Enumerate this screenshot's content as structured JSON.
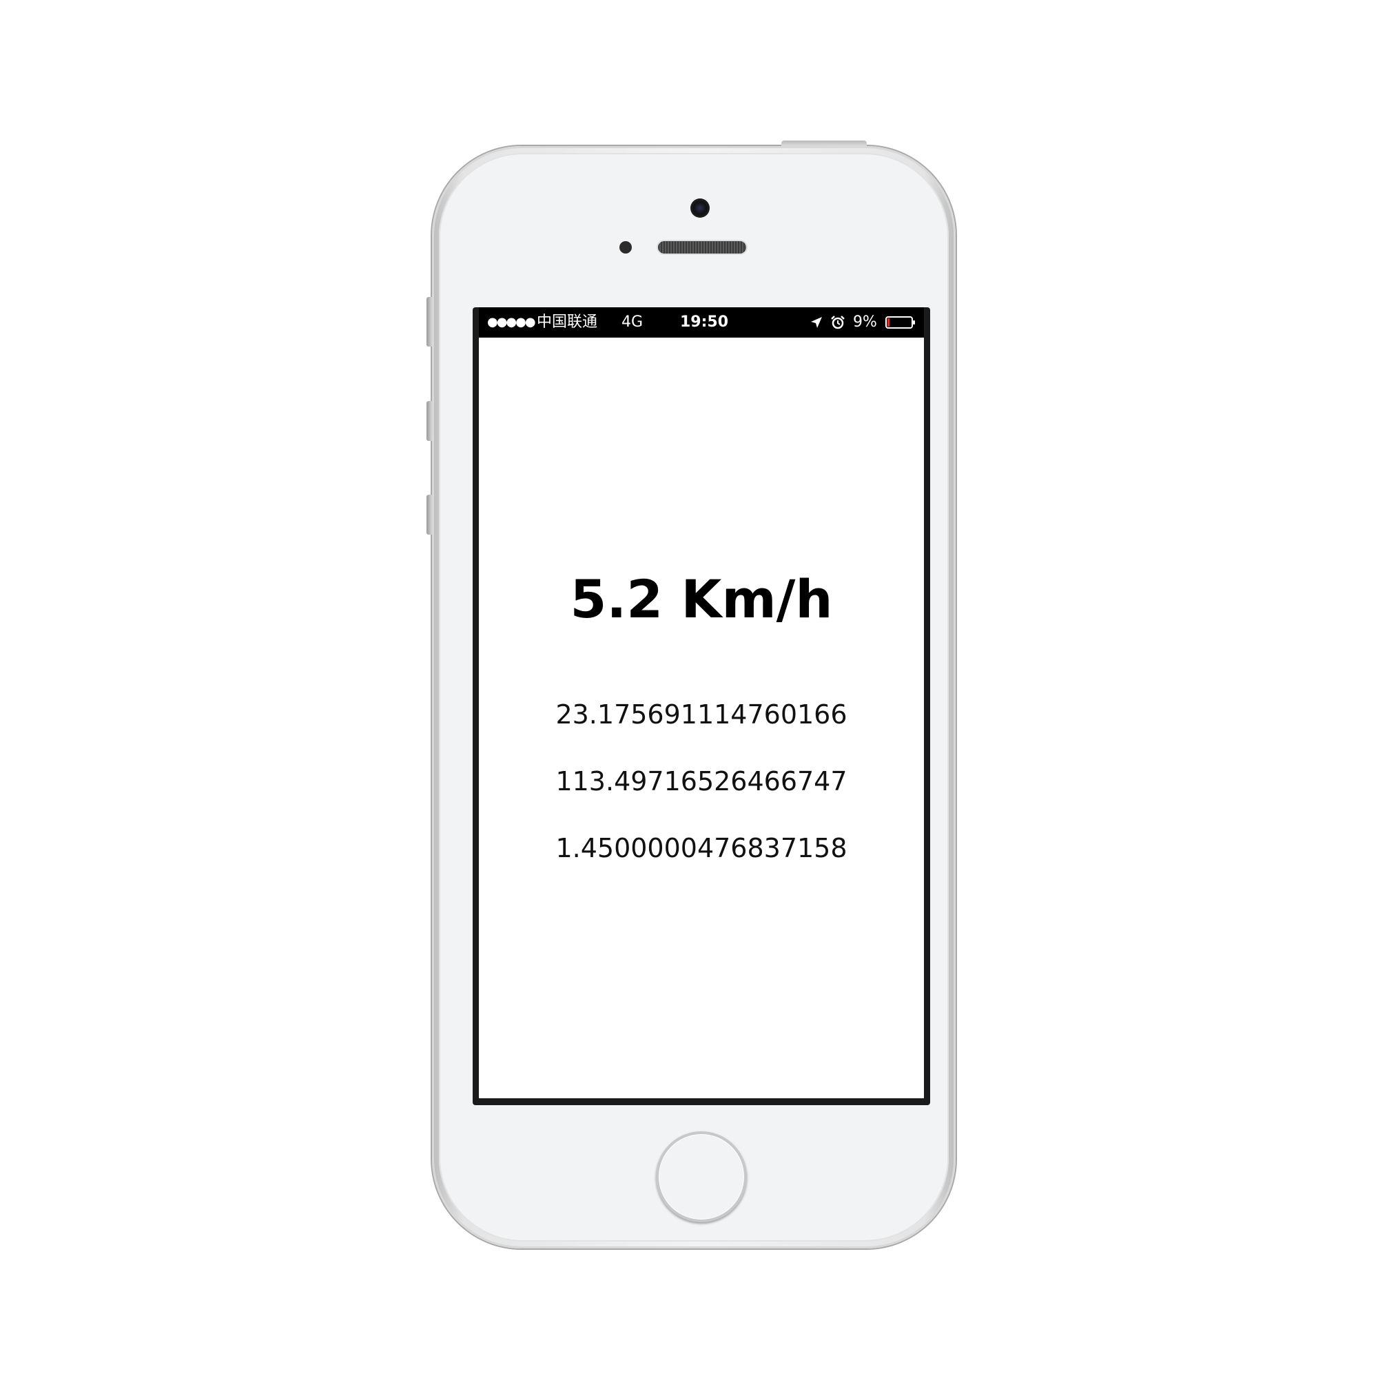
{
  "status_bar": {
    "signal": "●●●●●",
    "carrier": "中国联通",
    "network": "4G",
    "time": "19:50",
    "location_icon": "location-arrow-icon",
    "alarm_icon": "alarm-clock-icon",
    "battery_percent": "9%",
    "battery_level": 0.09,
    "battery_color": "#e0312b"
  },
  "main": {
    "speed": "5.2 Km/h",
    "latitude": "23.175691114760166",
    "longitude": "113.49716526466747",
    "third_value": "1.4500000476837158"
  }
}
